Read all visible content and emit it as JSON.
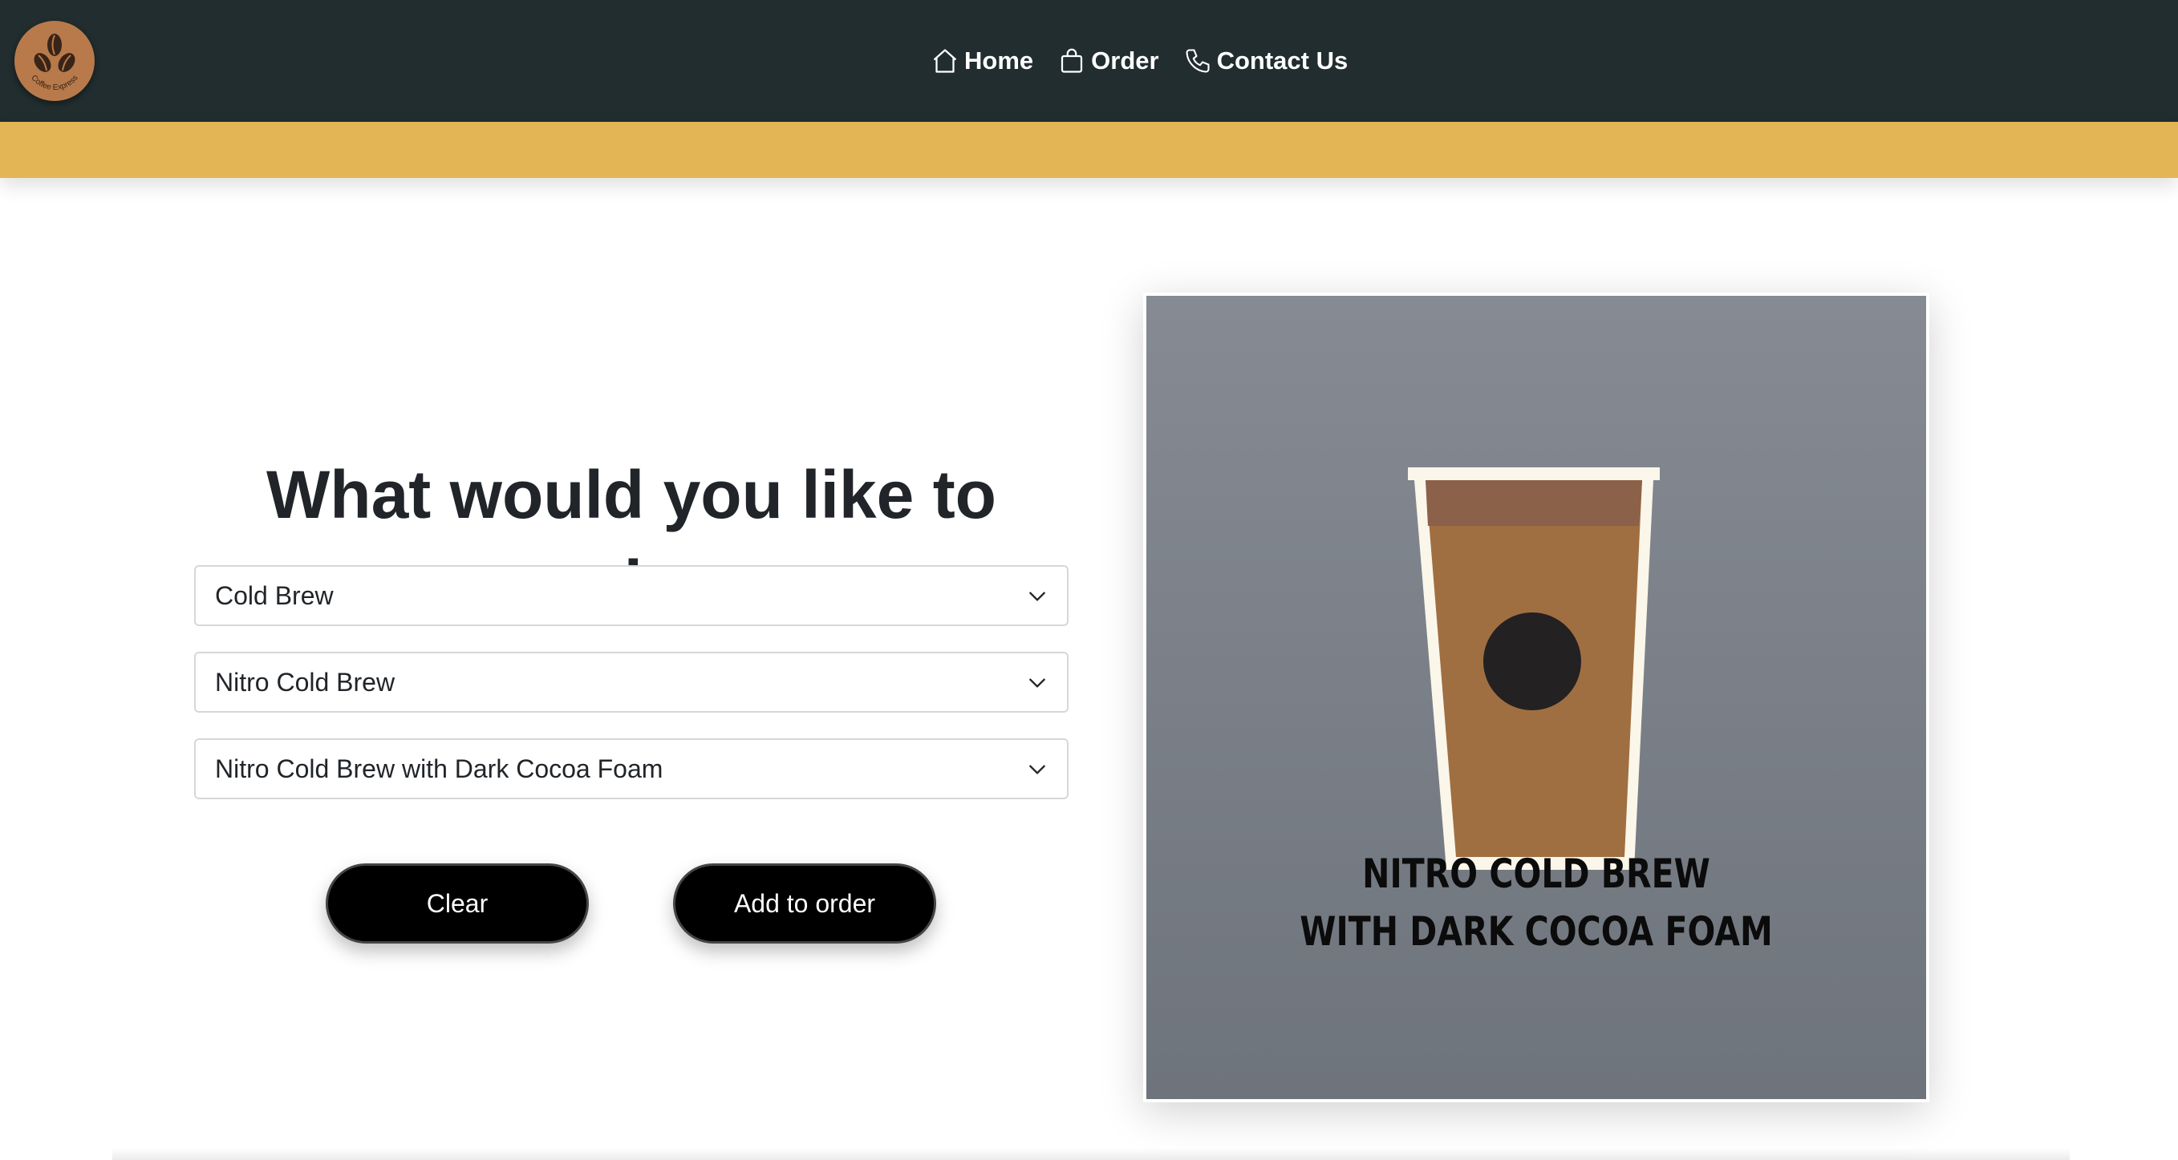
{
  "brand": {
    "logo_text": "Coffee Express"
  },
  "nav": {
    "items": [
      {
        "label": "Home",
        "icon": "house-icon"
      },
      {
        "label": "Order",
        "icon": "shopping-bag-icon"
      },
      {
        "label": "Contact Us",
        "icon": "phone-icon"
      }
    ]
  },
  "main": {
    "heading": "What would you like to order:",
    "selects": [
      {
        "value": "Cold Brew"
      },
      {
        "value": "Nitro Cold Brew"
      },
      {
        "value": "Nitro Cold Brew with Dark Cocoa Foam"
      }
    ],
    "buttons": {
      "clear": "Clear",
      "add": "Add to order"
    }
  },
  "product_image": {
    "caption_line1": "NITRO COLD BREW",
    "caption_line2": "WITH DARK COCOA FOAM"
  },
  "colors": {
    "navbar": "#212d2f",
    "accent_band": "#e3b555",
    "logo": "#b87a4b",
    "button": "#000000",
    "cup_coffee": "#a06f41",
    "cup_foam": "#8b614a"
  }
}
